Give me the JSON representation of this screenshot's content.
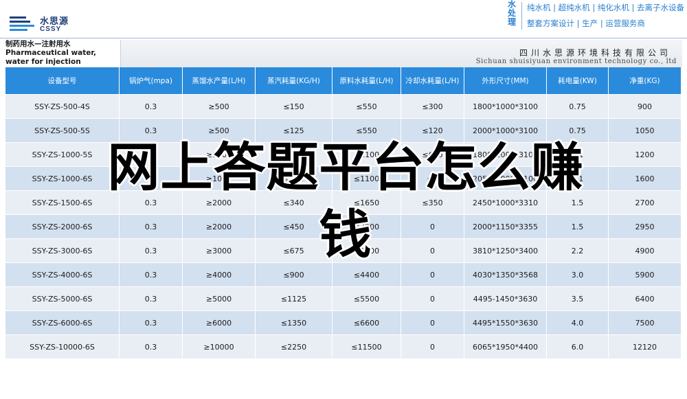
{
  "logo": {
    "name_cn": "水思源",
    "name_en": "CSSY",
    "color": "#1f3f7a"
  },
  "brand_slogan": {
    "vertical_text": "水处理",
    "line1": "纯水机 | 超纯水机 | 纯化水机 | 去离子水设备",
    "line2": "整套方案设计 | 生产 | 运营服务商",
    "color": "#2a7fd0"
  },
  "product": {
    "title": "制药用水—注射用水 Pharmaceutical water, water for injection"
  },
  "company": {
    "name_cn": "四川水思源环境科技有限公司",
    "name_en": "Sichuan shuisiyuan environment technology co., ltd"
  },
  "table": {
    "header_color": "#2a8bdc",
    "headers": [
      "设备型号",
      "锅炉气(mpa)",
      "蒸馏水产量(L/H)",
      "蒸汽耗量(KG/H)",
      "原料水耗量(L/H)",
      "冷却水耗量(L/H)",
      "外形尺寸(MM)",
      "耗电量(KW)",
      "净重(KG)"
    ],
    "rows": [
      [
        "SSY-ZS-500-4S",
        "0.3",
        "≥500",
        "≤150",
        "≤550",
        "≤300",
        "1800*1000*3100",
        "0.75",
        "900"
      ],
      [
        "SSY-ZS-500-5S",
        "0.3",
        "≥500",
        "≤125",
        "≤550",
        "≤120",
        "2000*1000*3100",
        "0.75",
        "1050"
      ],
      [
        "SSY-ZS-1000-5S",
        "0.3",
        "≥1000",
        "≤280",
        "≤1100",
        "≤600",
        "1800*1000*3100",
        "1.1",
        "1200"
      ],
      [
        "SSY-ZS-1000-6S",
        "0.3",
        "≥1000",
        "≤230",
        "≤1100",
        "≤0",
        "2050*1000*3100",
        "1.1",
        "1600"
      ],
      [
        "SSY-ZS-1500-6S",
        "0.3",
        "≥2000",
        "≤340",
        "≤1650",
        "≤350",
        "2450*1000*3310",
        "1.5",
        "2700"
      ],
      [
        "SSY-ZS-2000-6S",
        "0.3",
        "≥2000",
        "≤450",
        "≤2200",
        "0",
        "2000*1150*3355",
        "1.5",
        "2950"
      ],
      [
        "SSY-ZS-3000-6S",
        "0.3",
        "≥3000",
        "≤675",
        "≤3300",
        "0",
        "3810*1250*3400",
        "2.2",
        "4900"
      ],
      [
        "SSY-ZS-4000-6S",
        "0.3",
        "≥4000",
        "≤900",
        "≤4400",
        "0",
        "4030*1350*3568",
        "3.0",
        "5900"
      ],
      [
        "SSY-ZS-5000-6S",
        "0.3",
        "≥5000",
        "≤1125",
        "≤5500",
        "0",
        "4495-1450*3630",
        "3.5",
        "6400"
      ],
      [
        "SSY-ZS-6000-6S",
        "0.3",
        "≥6000",
        "≤1350",
        "≤6600",
        "0",
        "4495*1550*3630",
        "4.0",
        "7500"
      ],
      [
        "SSY-ZS-10000-6S",
        "0.3",
        "≥10000",
        "≤2250",
        "≤11500",
        "0",
        "6065*1950*4400",
        "6.0",
        "12120"
      ]
    ]
  },
  "overlay": {
    "line1": "网上答题平台怎么赚",
    "line2": "钱"
  }
}
